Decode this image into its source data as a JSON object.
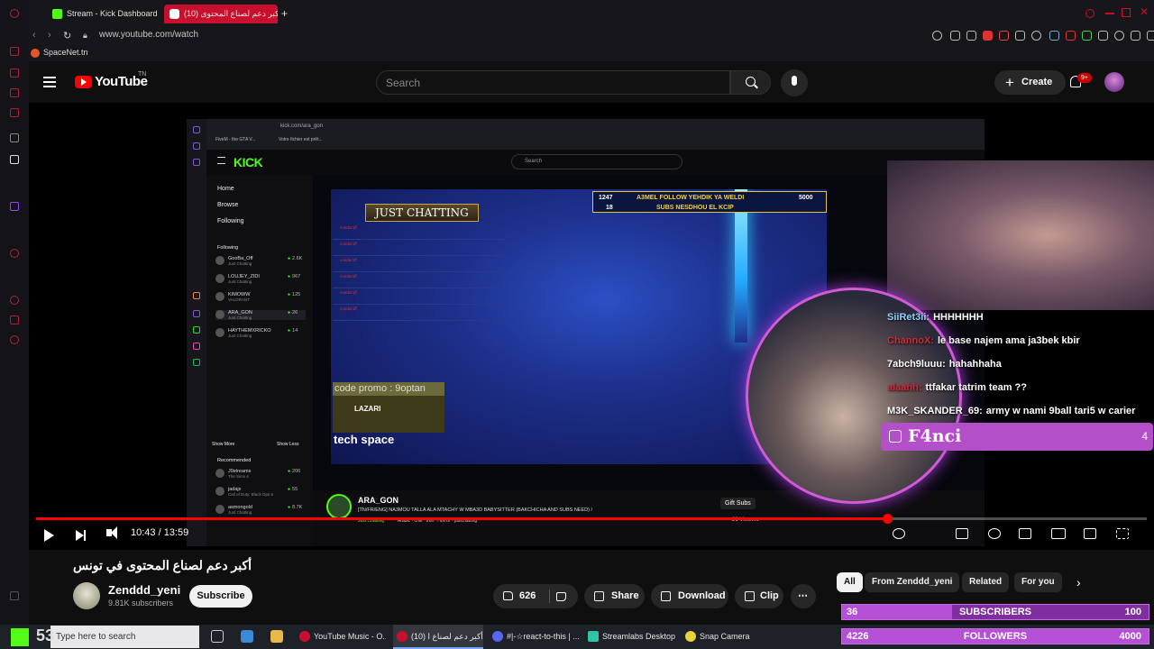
{
  "browser": {
    "tabs": [
      {
        "label": "Stream - Kick Dashboard",
        "active": false
      },
      {
        "label": "(10) أكبر دعم لصناع المحتوى",
        "active": true
      }
    ],
    "new_tab": "+",
    "url": "www.youtube.com/watch",
    "bookmarks": [
      "SpaceNet.tn"
    ]
  },
  "youtube": {
    "logo_text": "YouTube",
    "country": "TN",
    "search_placeholder": "Search",
    "create_label": "Create",
    "notif_count": "9+"
  },
  "video": {
    "title": "أكبر دعم لصناع المحتوى في تونس",
    "time": "10:43 / 13:59",
    "progress": 0.766,
    "channel": {
      "name": "Zenddd_yeni",
      "subs": "9.81K subscribers"
    },
    "subscribe_label": "Subscribe",
    "likes": "626",
    "share_label": "Share",
    "download_label": "Download",
    "clip_label": "Clip",
    "more_label": "⋯"
  },
  "chips": [
    "All",
    "From Zenddd_yeni",
    "Related",
    "For you"
  ],
  "stream": {
    "kick_url": "kick.com/ara_gon",
    "kick_search": "Search",
    "kick_logo": "KICK",
    "nav": [
      "Home",
      "Browse",
      "Following"
    ],
    "following_header": "Following",
    "following": [
      {
        "name": "GooBa_Off",
        "game": "Just Chatting",
        "count": "2.6K"
      },
      {
        "name": "LOUJEY_ZIDI",
        "game": "Just Chatting",
        "count": "967"
      },
      {
        "name": "KIMOWW",
        "game": "VALORANT",
        "count": "125"
      },
      {
        "name": "ARA_GON",
        "game": "Just Chatting",
        "count": "26"
      },
      {
        "name": "HAYTHEMXRICKO",
        "game": "Just Chatting",
        "count": "14"
      }
    ],
    "recommended_header": "Recommended",
    "recommended": [
      {
        "name": "J9streams",
        "game": "The Sims 4",
        "count": "206"
      },
      {
        "name": "jadajx",
        "game": "Call of Duty: Black Ops 6",
        "count": "55"
      },
      {
        "name": "asmongold",
        "game": "Just Chatting",
        "count": "8.7K"
      }
    ],
    "show_more": "Show More",
    "show_less": "Show Less",
    "just_chatting": "JUST CHATTING",
    "goal_line1": {
      "left": "1247",
      "mid": "A3MEL FOLLOW YEHDIK YA WELDI",
      "right": "5000"
    },
    "goal_line2": {
      "left": "18",
      "mid": "SUBS NESDHOU EL KCIP"
    },
    "chat_user": "condor1ff",
    "promo": "code promo : 9optan",
    "promo_brand": "LAZARI",
    "tech_space": "tech space",
    "streamer": "ARA_GON",
    "stream_title": "[TN/FR/ENG] NA3MOU TALLA ALA MTACHY W MBA3D BABYSITTER (BAKCHICHA AND SUBS NEED) /",
    "category": "Just Chatting",
    "tags": [
      "Arabic",
      "chill",
      "troll",
      "Horror",
      "justchatting"
    ],
    "gift_subs": "Gift Subs",
    "viewers": "26 Viewers"
  },
  "chat": [
    {
      "user": "SiiRet3ii:",
      "msg": "HHHHHHH",
      "color": "#8fd0ff"
    },
    {
      "user": "ChannoX:",
      "msg": "le base najem ama ja3bek kbir",
      "color": "#d6263a"
    },
    {
      "user": "7abch9luuu:",
      "msg": "hahahhaha",
      "color": "#ffffff"
    },
    {
      "user": "alaahh:",
      "msg": "ttfakar tatrim team ??",
      "color": "#d6263a"
    },
    {
      "user": "M3K_SKANDER_69:",
      "msg": "army w nami 9ball tari5 w carier",
      "color": "#ffffff"
    }
  ],
  "highlight": {
    "name": "F4nci",
    "count": "4"
  },
  "goals": {
    "subs": {
      "left": "36",
      "label": "SUBSCRIBERS",
      "right": "100",
      "fraction": 0.36
    },
    "followers": {
      "left": "4226",
      "label": "FOLLOWERS",
      "right": "4000",
      "fraction": 1
    }
  },
  "taskbar": {
    "search_placeholder": "Type here to search",
    "apps": [
      "YouTube Music - O...",
      "(10) أكبر دعم لصناع ا...",
      "#|-☆react-to-this | ...",
      "Streamlabs Desktop",
      "Snap Camera"
    ],
    "start_count": "53"
  },
  "colors": {
    "yt_red": "#ff0000",
    "kick_green": "#53fc18",
    "overlay_purple": "#b34fc8"
  }
}
